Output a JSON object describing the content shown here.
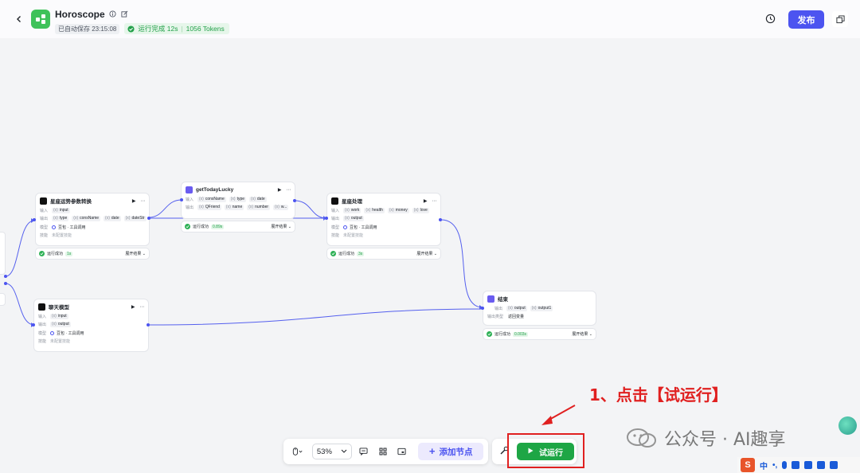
{
  "header": {
    "title": "Horoscope",
    "autosave": "已自动保存 23:15:08",
    "run_status": "运行完成 12s",
    "tokens": "1056 Tokens",
    "publish_label": "发布"
  },
  "nodes": {
    "convert": {
      "title": "星座运势参数转换",
      "input_label": "输入",
      "inputs": [
        "input"
      ],
      "output_label": "输出",
      "outputs": [
        "type",
        "consName",
        "date",
        "dateStr"
      ],
      "model_label": "模型",
      "model": "豆包 · 工具调用",
      "skill_label": "技能",
      "skill": "未配置技能",
      "status": "运行成功",
      "time": "1s",
      "expand": "展开结果 ⌄"
    },
    "lucky": {
      "title": "getTodayLucky",
      "input_label": "输入",
      "inputs": [
        "consName",
        "type",
        "date"
      ],
      "output_label": "输出",
      "outputs": [
        "QFriend",
        "name",
        "number",
        "w..."
      ],
      "status": "运行成功",
      "time": "0.89s",
      "expand": "展开结果 ⌄"
    },
    "process": {
      "title": "星座处理",
      "input_label": "输入",
      "inputs": [
        "work",
        "health",
        "money",
        "love"
      ],
      "output_label": "输出",
      "outputs": [
        "output"
      ],
      "model_label": "模型",
      "model": "豆包 · 工具调用",
      "skill_label": "技能",
      "skill": "未配置技能",
      "status": "运行成功",
      "time": "3s",
      "expand": "展开结果 ⌄"
    },
    "chat": {
      "title": "聊天模型",
      "input_label": "输入",
      "inputs": [
        "input"
      ],
      "output_label": "输出",
      "outputs": [
        "output"
      ],
      "model_label": "模型",
      "model": "豆包 · 工具调用",
      "skill_label": "技能",
      "skill": "未配置技能"
    },
    "end": {
      "title": "结束",
      "output_label": "输出",
      "outputs": [
        "output",
        "output1"
      ],
      "format_label": "输出类型",
      "format": "返回变量",
      "status": "运行成功",
      "time": "0.003s",
      "expand": "展开结果 ⌄"
    }
  },
  "toolbar": {
    "zoom": "53%",
    "add_node": "添加节点",
    "trial_run": "试运行"
  },
  "annotation": {
    "text": "1、点击【试运行】"
  },
  "watermark": {
    "text": "公众号 · AI趣享"
  },
  "ime": {
    "items": [
      "中",
      "•,"
    ]
  },
  "colors": {
    "accent": "#4c54f0",
    "success": "#1ea645",
    "annotation": "#e02020",
    "app_icon": "#3fc25a"
  }
}
